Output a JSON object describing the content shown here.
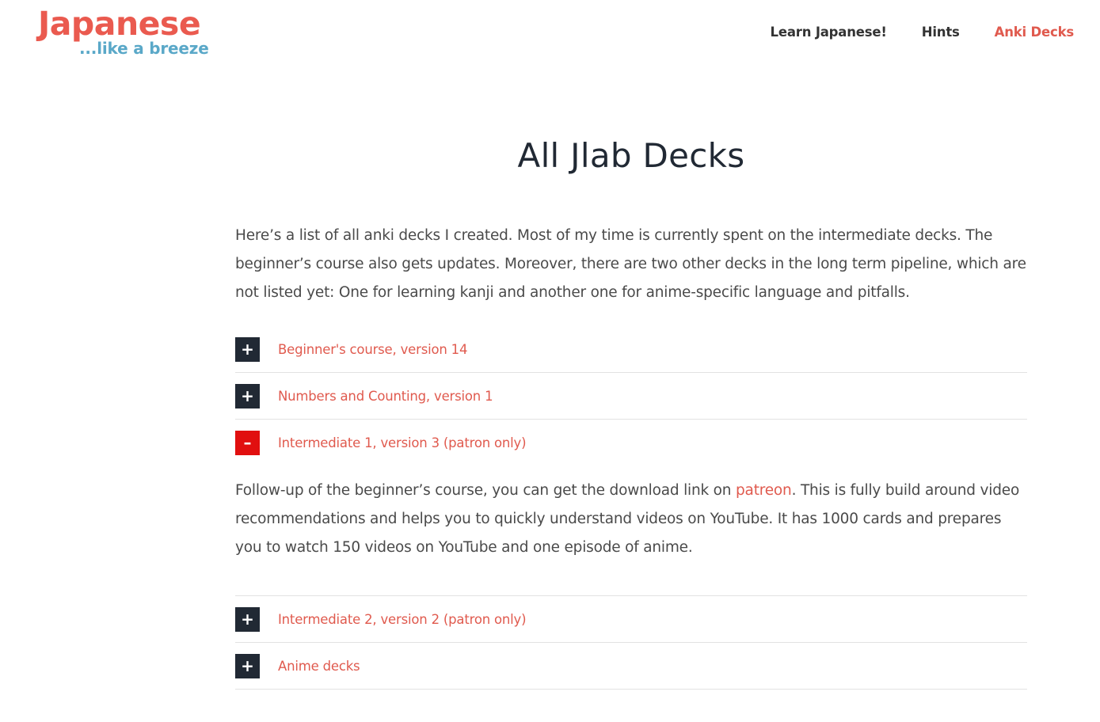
{
  "header": {
    "logo": {
      "main": "Japanese",
      "sub": "...like a breeze",
      "main_color": "#ea5a4f",
      "sub_color": "#5aa8c8"
    },
    "nav": [
      {
        "label": "Learn Japanese!",
        "active": false
      },
      {
        "label": "Hints",
        "active": false
      },
      {
        "label": "Anki Decks",
        "active": true
      }
    ]
  },
  "main": {
    "title": "All Jlab Decks",
    "intro": "Here’s a list of all anki decks I created. Most of my time is currently spent on the intermediate decks. The beginner’s course also gets updates. Moreover, there are two other decks in the long term pipeline, which are not listed yet: One for learning kanji and another one for anime-specific language and pitfalls.",
    "accordion": [
      {
        "title": "Beginner's course, version 14",
        "open": false,
        "icon": "plus-icon"
      },
      {
        "title": "Numbers and Counting, version 1",
        "open": false,
        "icon": "plus-icon"
      },
      {
        "title": "Intermediate 1, version 3 (patron only)",
        "open": true,
        "icon": "minus-icon",
        "body_before": "Follow-up of the beginner’s course, you can get the download link on ",
        "body_link": "patreon",
        "body_after": ". This is fully build around video recommendations and helps you to quickly understand videos on YouTube.  It has 1000 cards and prepares you to watch 150 videos on YouTube and one episode of anime."
      },
      {
        "title": "Intermediate 2, version 2 (patron only)",
        "open": false,
        "icon": "plus-icon"
      },
      {
        "title": "Anime decks",
        "open": false,
        "icon": "plus-icon"
      }
    ]
  },
  "colors": {
    "accent": "#e05a4e",
    "toggle_dark": "#212934",
    "toggle_open": "#e10f0f"
  }
}
